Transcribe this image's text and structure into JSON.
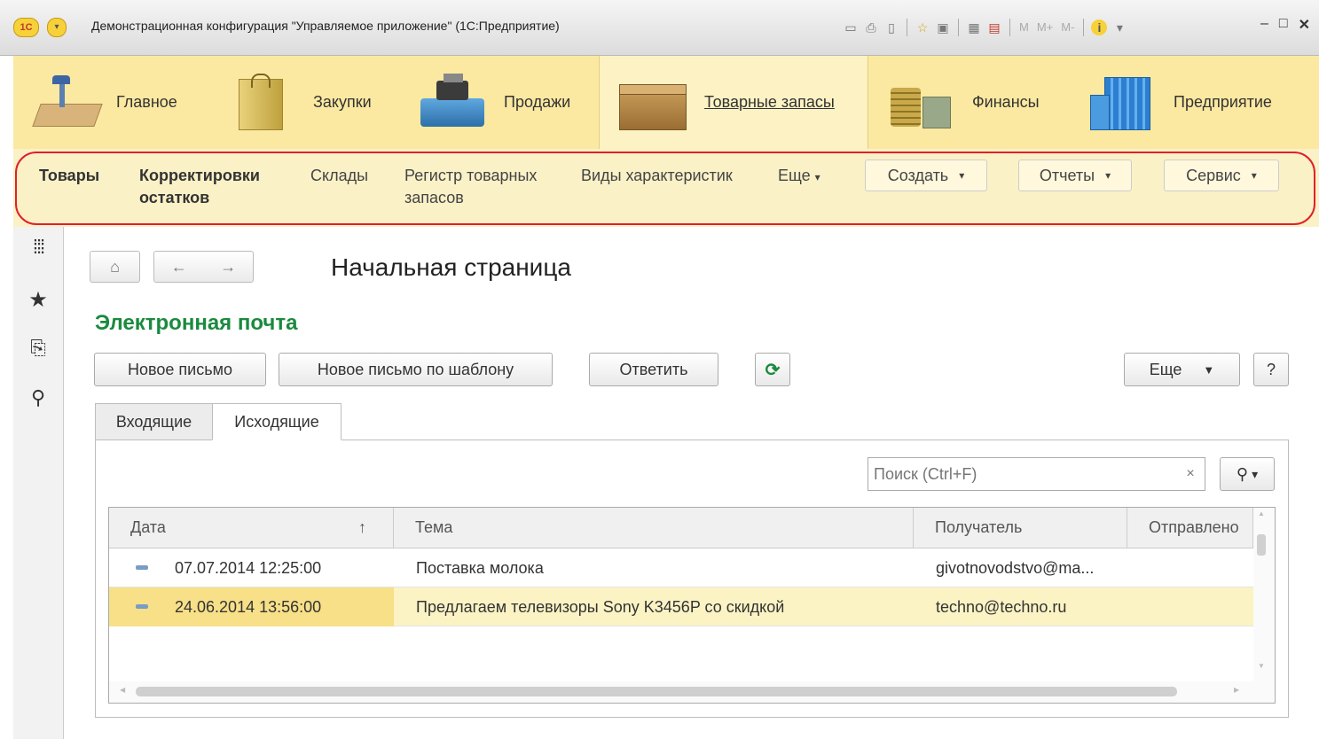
{
  "window": {
    "app_logo": "1С",
    "title": "Демонстрационная конфигурация \"Управляемое приложение\" (1С:Предприятие)",
    "toolbar_m": [
      "M",
      "M+",
      "M-"
    ],
    "controls": {
      "minimize": "–",
      "maximize": "□",
      "close": "✕"
    }
  },
  "sections": [
    {
      "label": "Главное",
      "icon": "desk-lamp-icon"
    },
    {
      "label": "Закупки",
      "icon": "shopping-bag-icon"
    },
    {
      "label": "Продажи",
      "icon": "cash-register-icon"
    },
    {
      "label": "Товарные запасы",
      "icon": "box-icon",
      "active": true
    },
    {
      "label": "Финансы",
      "icon": "coins-icon"
    },
    {
      "label": "Предприятие",
      "icon": "building-icon"
    }
  ],
  "commands": {
    "items": [
      [
        "Товары",
        ""
      ],
      [
        "Корректировки",
        "остатков"
      ],
      [
        "Склады",
        ""
      ],
      [
        "Регистр товарных",
        "запасов"
      ],
      [
        "Виды характеристик",
        ""
      ],
      [
        "Еще",
        ""
      ]
    ],
    "buttons": [
      "Создать",
      "Отчеты",
      "Сервис"
    ]
  },
  "nav": {
    "home": "⌂",
    "back": "←",
    "forward": "→"
  },
  "page_title": "Начальная страница",
  "section_title": "Электронная почта",
  "toolbar": {
    "new_letter": "Новое письмо",
    "new_from_template": "Новое письмо по шаблону",
    "reply": "Ответить",
    "more": "Еще",
    "help": "?"
  },
  "tabs": [
    "Входящие",
    "Исходящие"
  ],
  "search": {
    "placeholder": "Поиск (Ctrl+F)",
    "clear": "×"
  },
  "table": {
    "columns": [
      "Дата",
      "Тема",
      "Получатель",
      "Отправлено"
    ],
    "sort_indicator": "↑",
    "rows": [
      {
        "date": "07.07.2014 12:25:00",
        "subject": "Поставка молока",
        "recipient": "givotnovodstvo@ma...",
        "sent": ""
      },
      {
        "date": "24.06.2014 13:56:00",
        "subject": "Предлагаем телевизоры Sony K3456P со скидкой",
        "recipient": "techno@techno.ru",
        "sent": "",
        "selected": true
      }
    ]
  },
  "colors": {
    "accent_green": "#1a8a3e",
    "section_bar": "#fbe9a1",
    "highlight_oval": "#e0202a",
    "selected_row": "#fbf3c4"
  }
}
